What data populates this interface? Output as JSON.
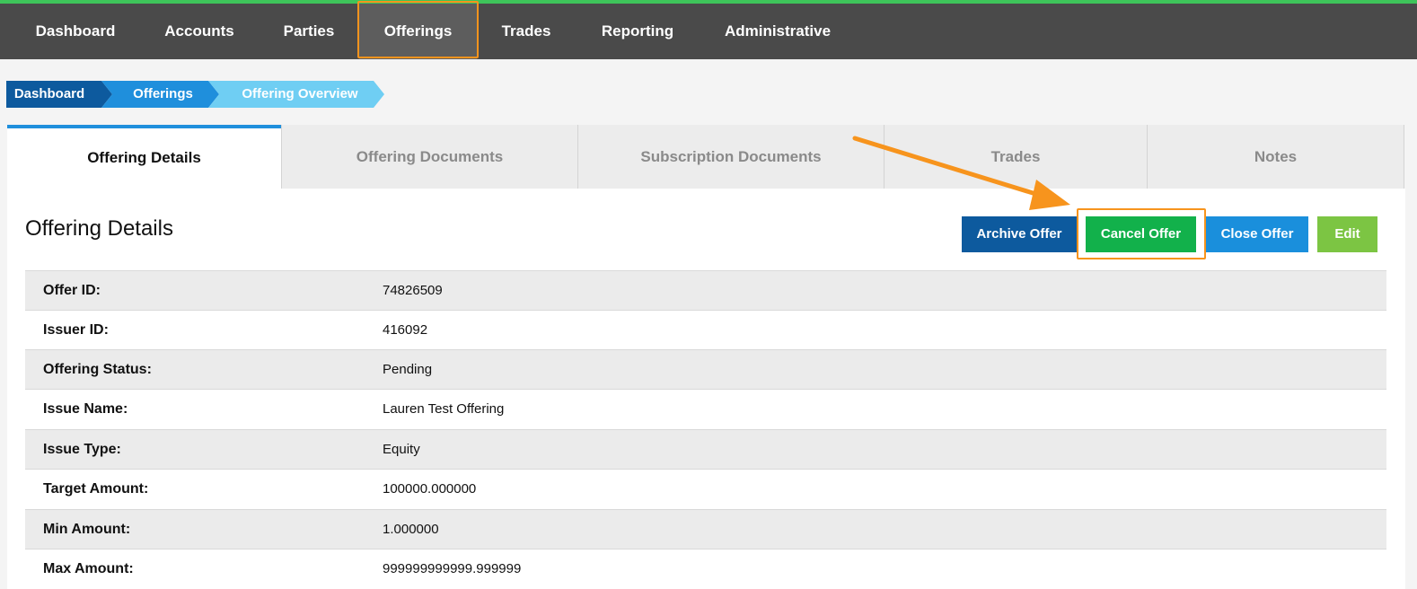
{
  "nav": {
    "items": [
      {
        "label": "Dashboard"
      },
      {
        "label": "Accounts"
      },
      {
        "label": "Parties"
      },
      {
        "label": "Offerings",
        "active": true
      },
      {
        "label": "Trades"
      },
      {
        "label": "Reporting"
      },
      {
        "label": "Administrative"
      }
    ]
  },
  "breadcrumb": [
    "Dashboard",
    "Offerings",
    "Offering Overview"
  ],
  "tabs": [
    {
      "label": "Offering Details",
      "active": true
    },
    {
      "label": "Offering Documents"
    },
    {
      "label": "Subscription Documents"
    },
    {
      "label": "Trades"
    },
    {
      "label": "Notes"
    }
  ],
  "section": {
    "title": "Offering Details"
  },
  "actions": {
    "archive": "Archive Offer",
    "cancel": "Cancel Offer",
    "close": "Close Offer",
    "edit": "Edit"
  },
  "details": [
    {
      "label": "Offer ID:",
      "value": "74826509"
    },
    {
      "label": "Issuer ID:",
      "value": "416092"
    },
    {
      "label": "Offering Status:",
      "value": "Pending"
    },
    {
      "label": "Issue Name:",
      "value": "Lauren Test Offering"
    },
    {
      "label": "Issue Type:",
      "value": "Equity"
    },
    {
      "label": "Target Amount:",
      "value": "100000.000000"
    },
    {
      "label": "Min Amount:",
      "value": "1.000000"
    },
    {
      "label": "Max Amount:",
      "value": "999999999999.999999"
    }
  ],
  "colors": {
    "nav_bg": "#4a4a4a",
    "nav_top_border": "#3ec45a",
    "highlight": "#f7941d",
    "crumb_1": "#0d5a9e",
    "crumb_2": "#1f8fdc",
    "crumb_3": "#6fcef3",
    "archive_btn": "#0d5a9e",
    "cancel_btn": "#12b14b",
    "close_btn": "#1a8fdc",
    "edit_btn": "#7cc543",
    "tab_active_border": "#1f8fdc"
  }
}
